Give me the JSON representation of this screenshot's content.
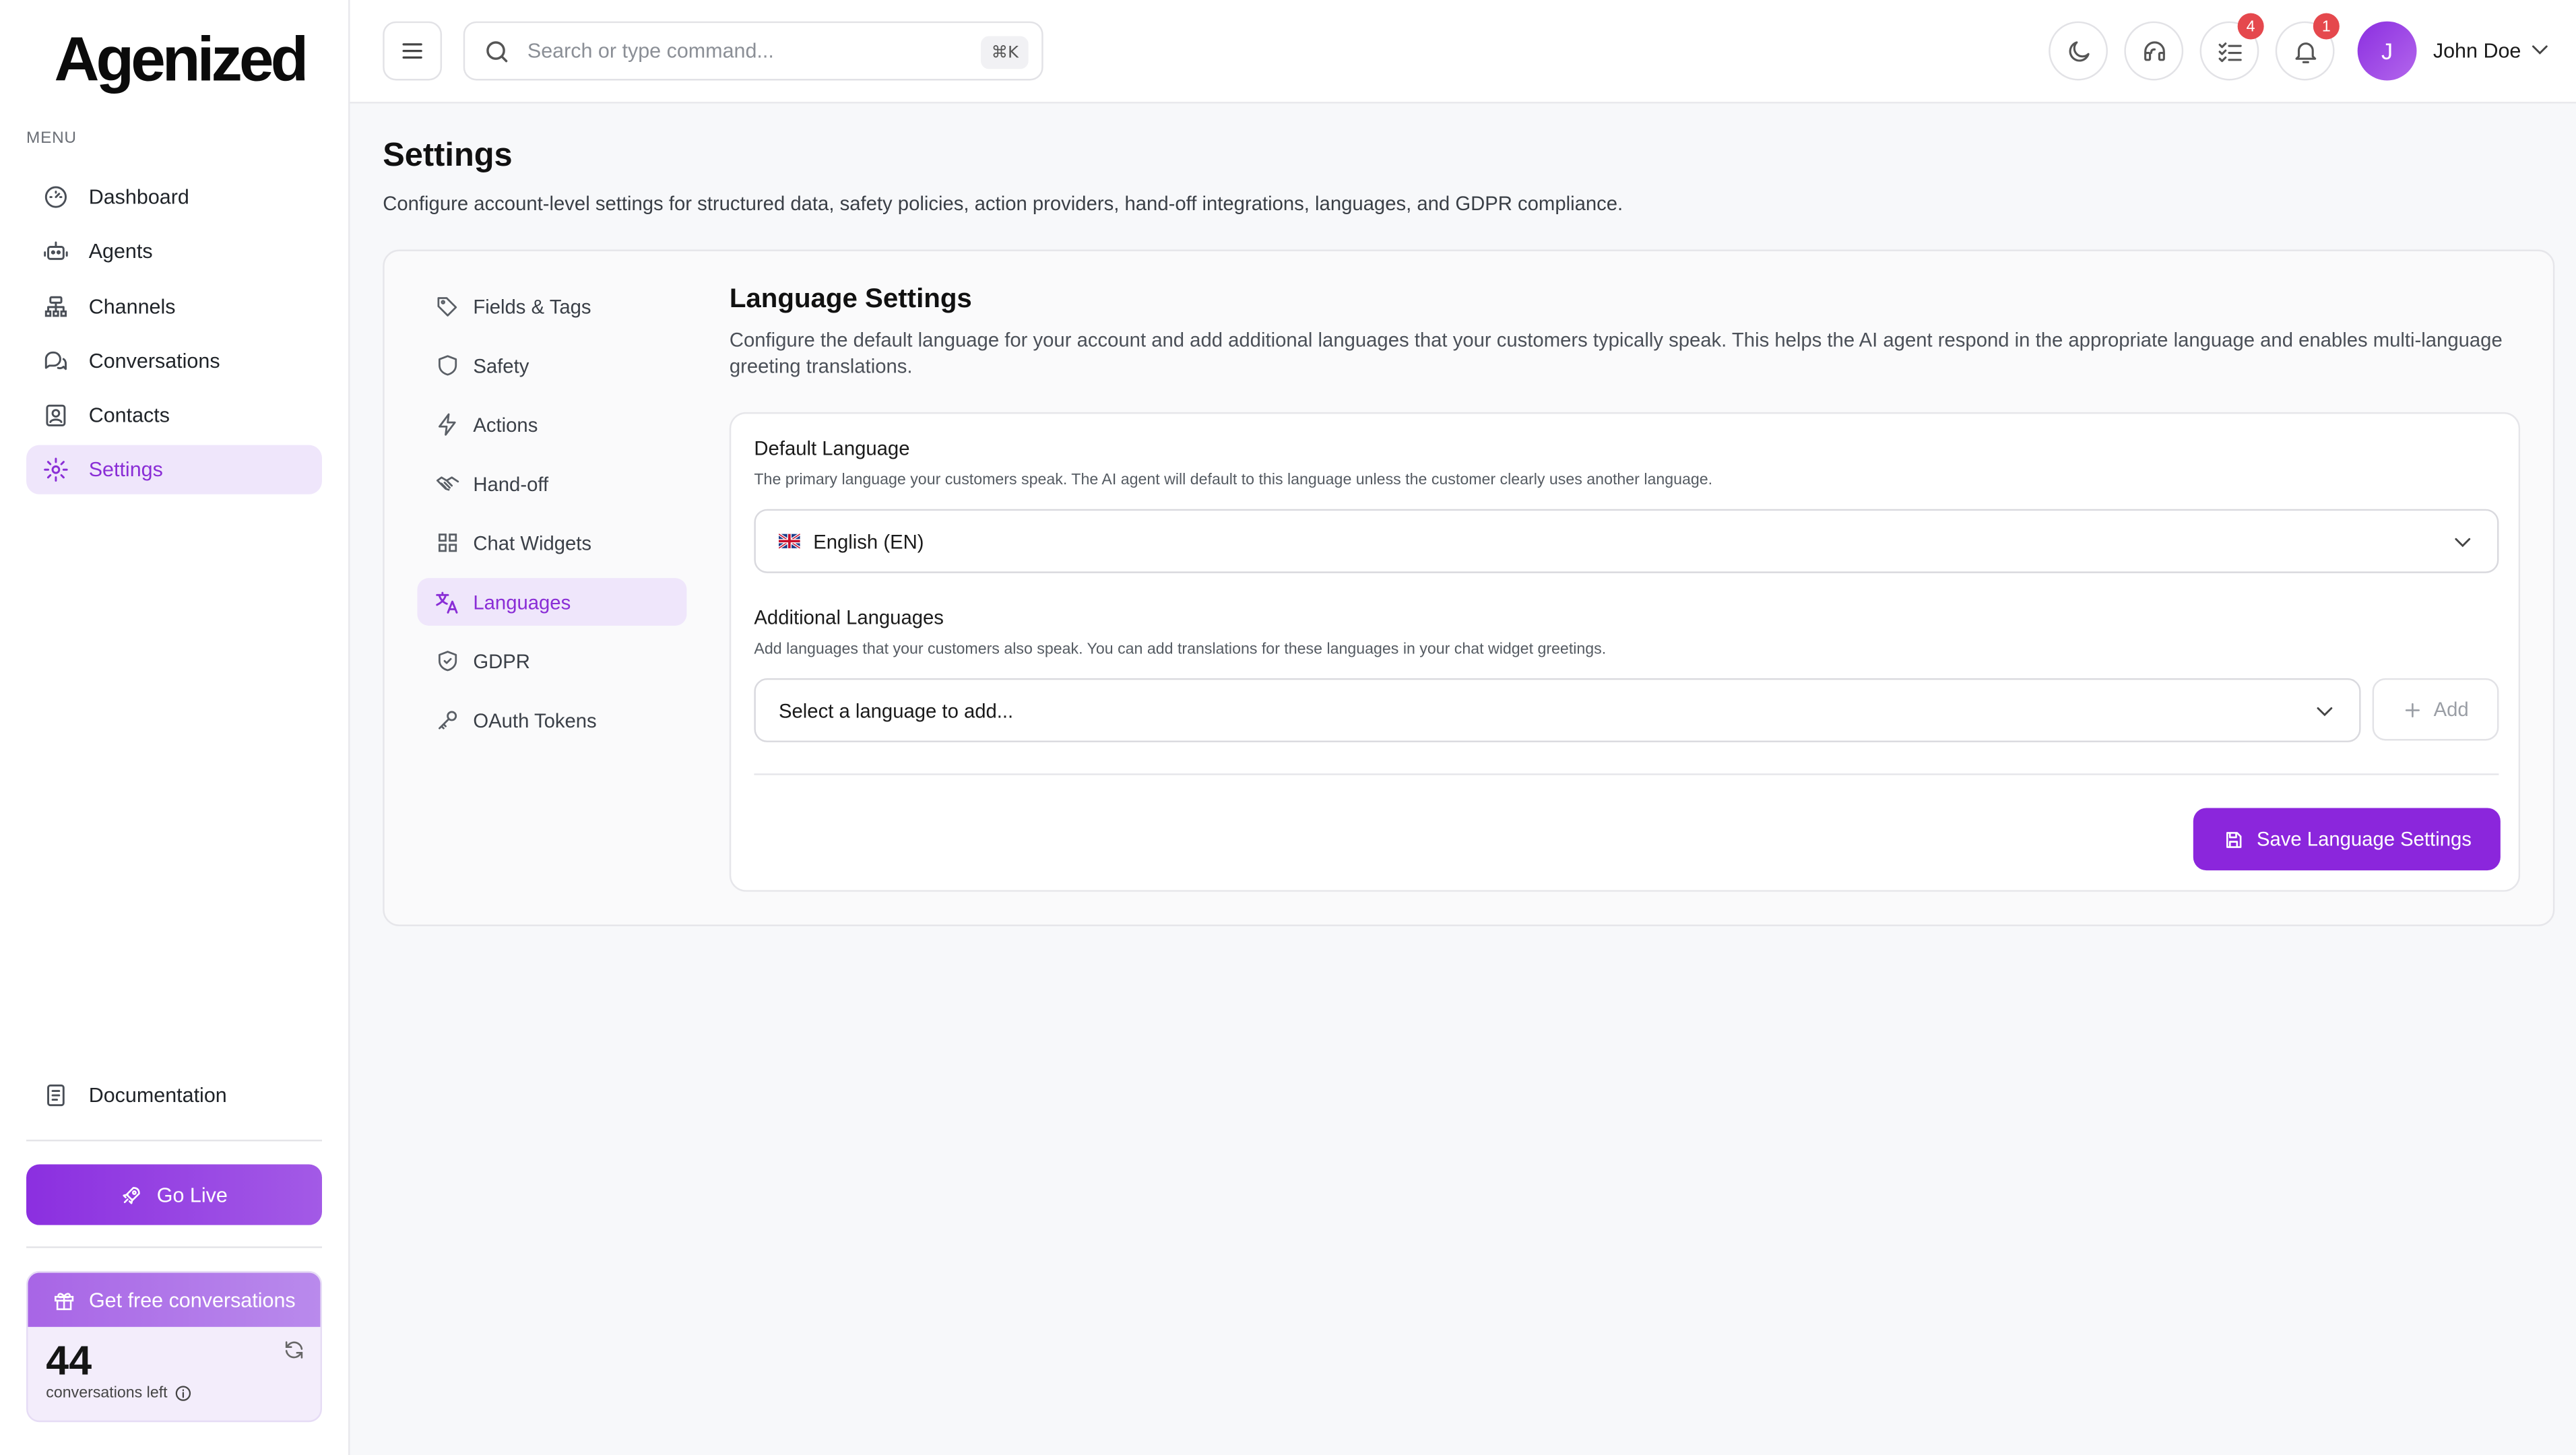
{
  "brand": {
    "logo_text": "Agenized"
  },
  "sidebar": {
    "menu_label": "MENU",
    "items": [
      {
        "label": "Dashboard",
        "icon": "dashboard-icon",
        "active": false
      },
      {
        "label": "Agents",
        "icon": "robot-icon",
        "active": false
      },
      {
        "label": "Channels",
        "icon": "channels-icon",
        "active": false
      },
      {
        "label": "Conversations",
        "icon": "chat-icon",
        "active": false
      },
      {
        "label": "Contacts",
        "icon": "contacts-icon",
        "active": false
      },
      {
        "label": "Settings",
        "icon": "gear-icon",
        "active": true
      }
    ],
    "documentation": "Documentation",
    "go_live": "Go Live",
    "promo": {
      "title": "Get free conversations",
      "count": "44",
      "subtitle": "conversations left"
    }
  },
  "topbar": {
    "search": {
      "placeholder": "Search or type command...",
      "shortcut": "⌘K"
    },
    "tasks_badge": "4",
    "notifications_badge": "1",
    "user": {
      "initial": "J",
      "name": "John Doe"
    }
  },
  "page": {
    "title": "Settings",
    "description": "Configure account-level settings for structured data, safety policies, action providers, hand-off integrations, languages, and GDPR compliance."
  },
  "settings_nav": [
    {
      "label": "Fields & Tags",
      "icon": "tag-icon",
      "active": false
    },
    {
      "label": "Safety",
      "icon": "shield-icon",
      "active": false
    },
    {
      "label": "Actions",
      "icon": "lightning-icon",
      "active": false
    },
    {
      "label": "Hand-off",
      "icon": "handshake-icon",
      "active": false
    },
    {
      "label": "Chat Widgets",
      "icon": "grid-icon",
      "active": false
    },
    {
      "label": "Languages",
      "icon": "translate-icon",
      "active": true
    },
    {
      "label": "GDPR",
      "icon": "shield-check-icon",
      "active": false
    },
    {
      "label": "OAuth Tokens",
      "icon": "key-icon",
      "active": false
    }
  ],
  "language_settings": {
    "title": "Language Settings",
    "description": "Configure the default language for your account and add additional languages that your customers typically speak. This helps the AI agent respond in the appropriate language and enables multi-language greeting translations.",
    "default_language": {
      "label": "Default Language",
      "help": "The primary language your customers speak. The AI agent will default to this language unless the customer clearly uses another language.",
      "value": "English (EN)"
    },
    "additional_languages": {
      "label": "Additional Languages",
      "help": "Add languages that your customers also speak. You can add translations for these languages in your chat widget greetings.",
      "placeholder": "Select a language to add...",
      "add_label": "Add"
    },
    "save_label": "Save Language Settings"
  },
  "colors": {
    "accent": "#8b26dc",
    "accent_light": "#efe6fb",
    "badge": "#e5484d"
  }
}
